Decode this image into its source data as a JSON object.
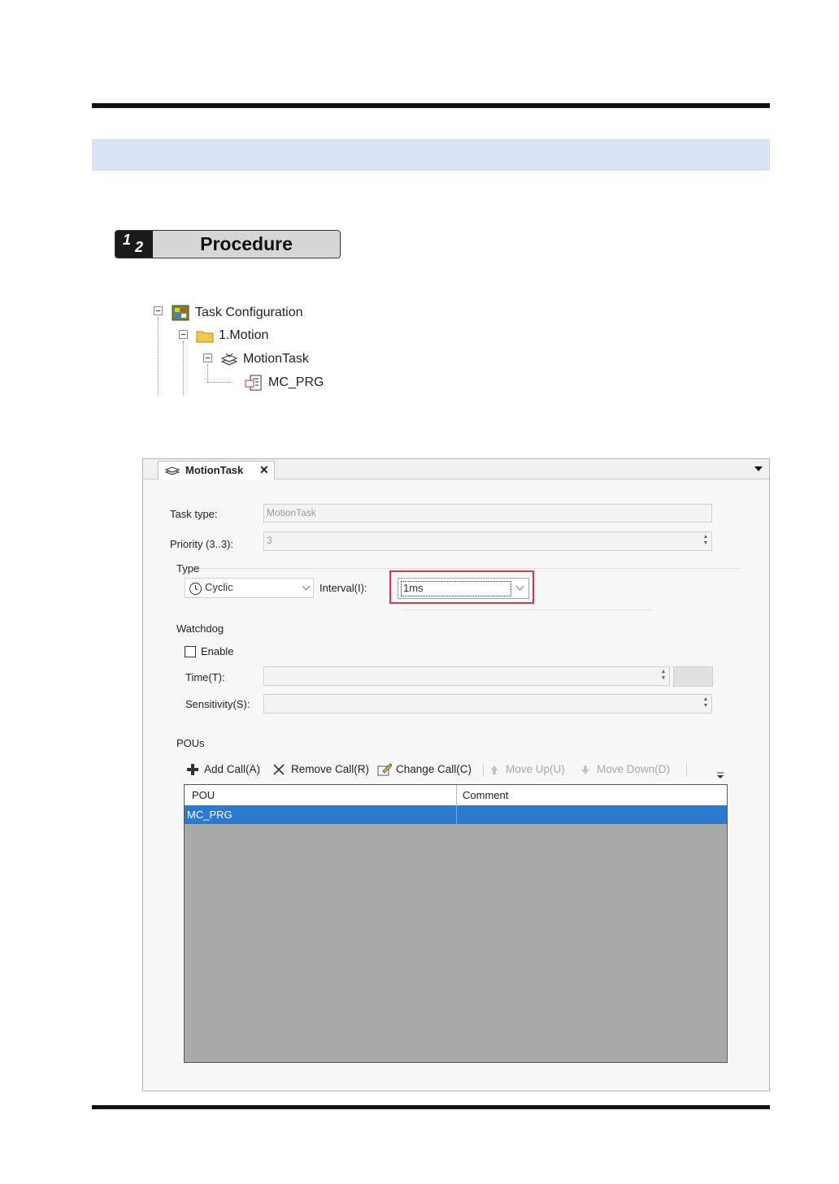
{
  "procedure": {
    "num1": "1",
    "num2": "2",
    "label": "Procedure"
  },
  "tree": {
    "root": "Task Configuration",
    "folder": "1.Motion",
    "task": "MotionTask",
    "program": "MC_PRG"
  },
  "window": {
    "tab_label": "MotionTask",
    "tab_close": "✕",
    "task_type_label": "Task type:",
    "task_type_value": "MotionTask",
    "priority_label": "Priority (3..3):",
    "priority_value": "3",
    "type_group": "Type",
    "type_value": "Cyclic",
    "interval_label": "Interval(I):",
    "interval_value": "1ms",
    "watchdog_group": "Watchdog",
    "enable_label": "Enable",
    "time_label": "Time(T):",
    "sensitivity_label": "Sensitivity(S):",
    "pous_group": "POUs",
    "toolbar": {
      "add": "Add Call(A)",
      "remove": "Remove Call(R)",
      "change": "Change Call(C)",
      "move_up": "Move Up(U)",
      "move_down": "Move Down(D)"
    },
    "table": {
      "columns": [
        "POU",
        "Comment"
      ],
      "rows": [
        {
          "pou": "MC_PRG",
          "comment": ""
        }
      ]
    }
  },
  "colors": {
    "highlight": "#e0344a",
    "selection": "#2a7ad0",
    "band": "#d9e2f5"
  }
}
